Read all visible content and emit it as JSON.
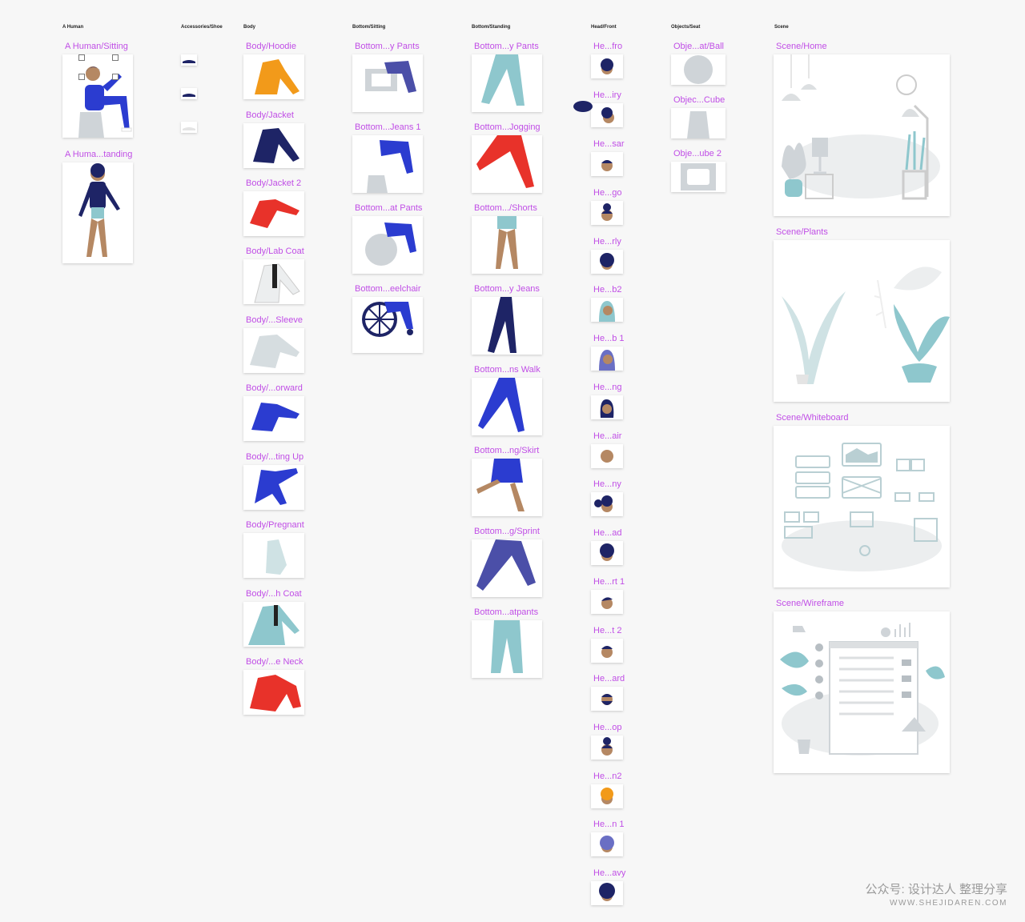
{
  "columns": {
    "a_human": "A Human",
    "accessories_shoe": "Accessories/Shoe",
    "body": "Body",
    "bottom_sitting": "Bottom/Sitting",
    "bottom_standing": "Bottom/Standing",
    "head_front": "Head/Front",
    "objects_seat": "Objects/Seat",
    "scene": "Scene"
  },
  "a_human": [
    "A Human/Sitting",
    "A Huma...tanding"
  ],
  "body": [
    "Body/Hoodie",
    "Body/Jacket",
    "Body/Jacket 2",
    "Body/Lab Coat",
    "Body/...Sleeve",
    "Body/...orward",
    "Body/...ting Up",
    "Body/Pregnant",
    "Body/...h Coat",
    "Body/...e Neck"
  ],
  "bottom_sitting": [
    "Bottom...y Pants",
    "Bottom...Jeans 1",
    "Bottom...at Pants",
    "Bottom...eelchair"
  ],
  "bottom_standing": [
    "Bottom...y Pants",
    "Bottom...Jogging",
    "Bottom.../Shorts",
    "Bottom...y Jeans",
    "Bottom...ns Walk",
    "Bottom...ng/Skirt",
    "Bottom...g/Sprint",
    "Bottom...atpants"
  ],
  "head_front": [
    "He...fro",
    "He...iry",
    "He...sar",
    "He...go",
    "He...rly",
    "He...b2",
    "He...b 1",
    "He...ng",
    "He...air",
    "He...ny",
    "He...ad",
    "He...rt 1",
    "He...t 2",
    "He...ard",
    "He...op",
    "He...n2",
    "He...n 1",
    "He...avy"
  ],
  "objects_seat": [
    "Obje...at/Ball",
    "Objec...Cube",
    "Obje...ube 2"
  ],
  "scene": [
    "Scene/Home",
    "Scene/Plants",
    "Scene/Whiteboard",
    "Scene/Wireframe"
  ],
  "watermark": {
    "main": "公众号: 设计达人 整理分享",
    "sub": "WWW.SHEJIDAREN.COM"
  },
  "colors": {
    "label": "#c04ee6",
    "canvas": "#f7f7f7",
    "navy": "#1e2466",
    "blue": "#2b3cd0",
    "orange": "#f29a1a",
    "red": "#e8322a",
    "teal": "#8ec7cd",
    "skin": "#b58863"
  }
}
